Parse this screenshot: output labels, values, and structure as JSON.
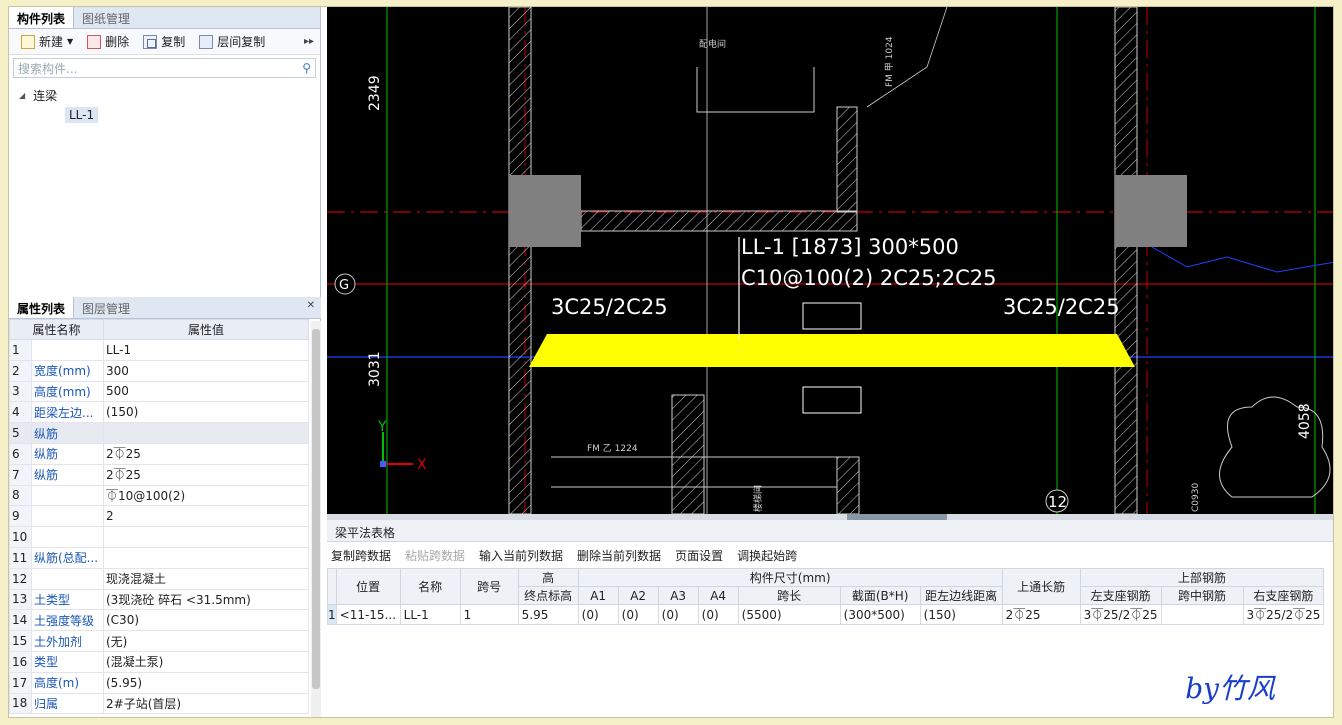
{
  "tabs_top": [
    "构件列表",
    "图纸管理"
  ],
  "toolbar": {
    "new": "新建",
    "delete": "删除",
    "copy": "复制",
    "floor_copy": "层间复制"
  },
  "search": {
    "placeholder": "搜索构件..."
  },
  "tree": {
    "root": "连梁",
    "child": "LL-1"
  },
  "tabs_props": [
    "属性列表",
    "图层管理"
  ],
  "props": {
    "header": [
      "属性名称",
      "属性值"
    ],
    "rows": [
      {
        "n": "1",
        "name": "",
        "value": "LL-1"
      },
      {
        "n": "2",
        "name": "宽度(mm)",
        "value": "300"
      },
      {
        "n": "3",
        "name": "高度(mm)",
        "value": "500"
      },
      {
        "n": "4",
        "name": "距梁左边...",
        "value": "(150)"
      },
      {
        "n": "5",
        "name": "纵筋",
        "value": ""
      },
      {
        "n": "6",
        "name": "纵筋",
        "value": "2⏁25"
      },
      {
        "n": "7",
        "name": "纵筋",
        "value": "2⏁25"
      },
      {
        "n": "8",
        "name": "",
        "value": "⏁10@100(2)"
      },
      {
        "n": "9",
        "name": "",
        "value": "2"
      },
      {
        "n": "10",
        "name": "",
        "value": ""
      },
      {
        "n": "11",
        "name": "纵筋(总配...",
        "value": ""
      },
      {
        "n": "12",
        "name": "",
        "value": "现浇混凝土"
      },
      {
        "n": "13",
        "name": "土类型",
        "value": "(3现浇砼 碎石 <31.5mm)"
      },
      {
        "n": "14",
        "name": "土强度等级",
        "value": "(C30)"
      },
      {
        "n": "15",
        "name": "土外加剂",
        "value": "(无)"
      },
      {
        "n": "16",
        "name": "类型",
        "value": "(混凝土泵)"
      },
      {
        "n": "17",
        "name": "高度(m)",
        "value": "(5.95)"
      },
      {
        "n": "18",
        "name": "归属",
        "value": "2#子站(首层)"
      }
    ]
  },
  "cad": {
    "beam_label": "LL-1 [1873] 300*500",
    "stirrup_label": "C10@100(2) 2C25;2C25",
    "left_support": "3C25/2C25",
    "right_support": "3C25/2C25",
    "dim_top": "2349",
    "dim_mid": "3031",
    "dim_right": "4058",
    "axis_g": "G",
    "axis_12": "12",
    "axis_x": "X",
    "axis_y": "Y",
    "text_room": "配电间",
    "text_fm1": "FM 甲 1024",
    "text_fm2": "FM 乙 1224",
    "text_vert": "楼梯间",
    "text_c": "C0930"
  },
  "bottom": {
    "title": "梁平法表格",
    "tools": [
      "复制跨数据",
      "粘贴跨数据",
      "输入当前列数据",
      "删除当前列数据",
      "页面设置",
      "调换起始跨"
    ],
    "disabled_tool": "粘贴跨数据",
    "group_headers": {
      "height": "高",
      "size": "构件尺寸(mm)",
      "top_rebar": "上部钢筋"
    },
    "headers": [
      "位置",
      "名称",
      "跨号",
      "终点标高",
      "A1",
      "A2",
      "A3",
      "A4",
      "跨长",
      "截面(B*H)",
      "距左边线距离",
      "上通长筋",
      "左支座钢筋",
      "跨中钢筋",
      "右支座钢筋"
    ],
    "row": {
      "no": "1",
      "cells": [
        "<11-15...",
        "LL-1",
        "1",
        "5.95",
        "(0)",
        "(0)",
        "(0)",
        "(0)",
        "(5500)",
        "(300*500)",
        "(150)",
        "2⏁25",
        "3⏁25/2⏁25",
        "",
        "3⏁25/2⏁25"
      ]
    }
  },
  "signature": "by竹风",
  "colors": {
    "beam": "#ffff00",
    "grid_red": "#c00000",
    "grid_green": "#00c000",
    "grid_blue": "#2040ff",
    "column": "#808080"
  }
}
